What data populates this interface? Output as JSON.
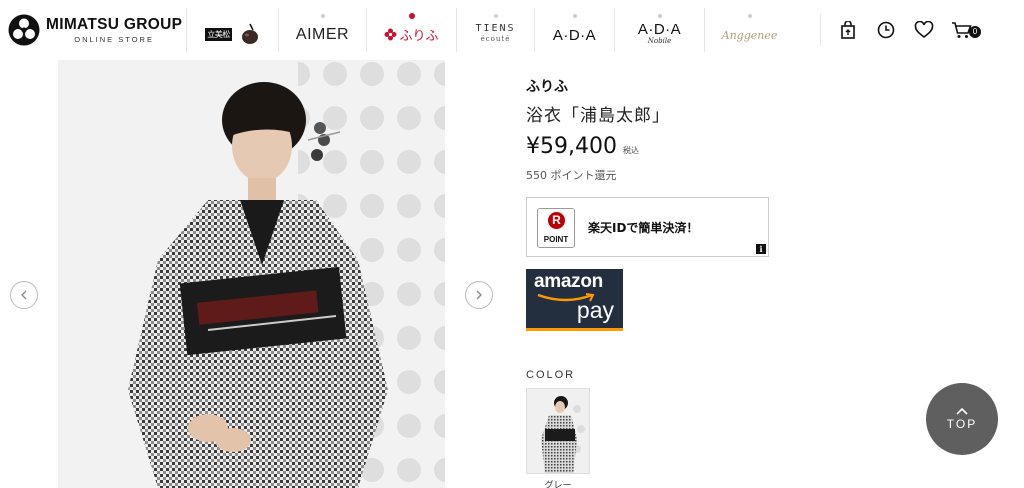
{
  "header": {
    "logo": {
      "title": "MIMATSU GROUP",
      "subtitle": "ONLINE STORE"
    },
    "brands": [
      {
        "name": "立美松",
        "label": ""
      },
      {
        "name": "AIMER",
        "label": "AIMER"
      },
      {
        "name": "furifu",
        "label": "ふりふ"
      },
      {
        "name": "TIENS ecoute",
        "label": "TIENS",
        "sub": "écouté"
      },
      {
        "name": "A·D·A",
        "label": "A·D·A"
      },
      {
        "name": "A·D·A Nobile",
        "label": "A·D·A",
        "sub": "Nobile"
      },
      {
        "name": "Anggenee",
        "label": "Anggenee"
      }
    ],
    "icons": [
      "store-icon",
      "history-icon",
      "favorite-icon",
      "cart-icon"
    ],
    "cart_count": "0"
  },
  "product": {
    "brand": "ふりふ",
    "name": "浴衣「浦島太郎」",
    "price": "¥59,400",
    "tax_label": "税込",
    "points": "550 ポイント還元"
  },
  "payments": {
    "rakuten": {
      "badge_r": "R",
      "badge_label": "POINT",
      "text": "楽天IDで簡単決済！",
      "info": "i"
    },
    "amazon": {
      "line1": "amazon",
      "line2": "pay"
    }
  },
  "colors": {
    "label": "COLOR",
    "options": [
      {
        "name": "グレー"
      }
    ]
  },
  "top_button": {
    "label": "TOP"
  },
  "colors_theme": {
    "rakuten_red": "#bf0000",
    "amazon_dark": "#232f3e",
    "amazon_orange": "#ff9900",
    "furifu_red": "#c8102e",
    "top_btn": "#5f5f5f"
  }
}
